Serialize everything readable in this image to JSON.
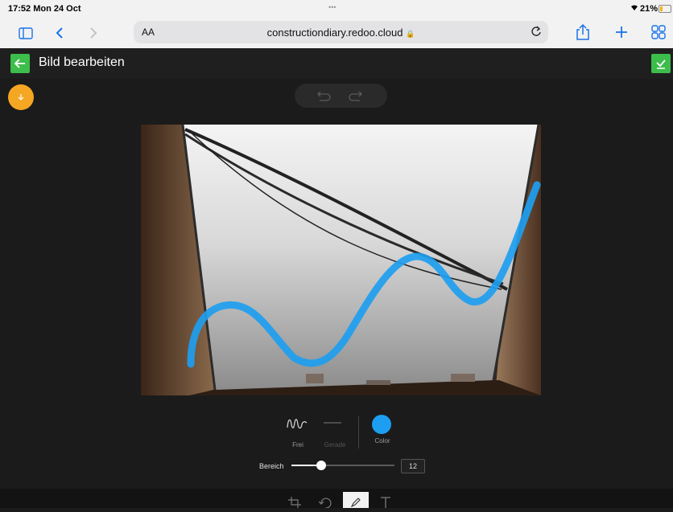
{
  "status": {
    "time_date": "17:52  Mon 24 Oct",
    "dots": "•••",
    "battery": "21%"
  },
  "browser": {
    "aa": "AA",
    "url": "constructiondiary.redoo.cloud",
    "lock": "🔒"
  },
  "header": {
    "title": "Bild bearbeiten",
    "accent": "#3dbd4b"
  },
  "tools": {
    "free_label": "Frei",
    "straight_label": "Gerade",
    "color_label": "Color",
    "color_value": "#1e9ef0",
    "range_label": "Bereich",
    "range_value": "12",
    "slider_fraction": 0.29
  },
  "bottom_icons": [
    "crop-icon",
    "rotate-icon",
    "draw-icon",
    "text-icon"
  ]
}
